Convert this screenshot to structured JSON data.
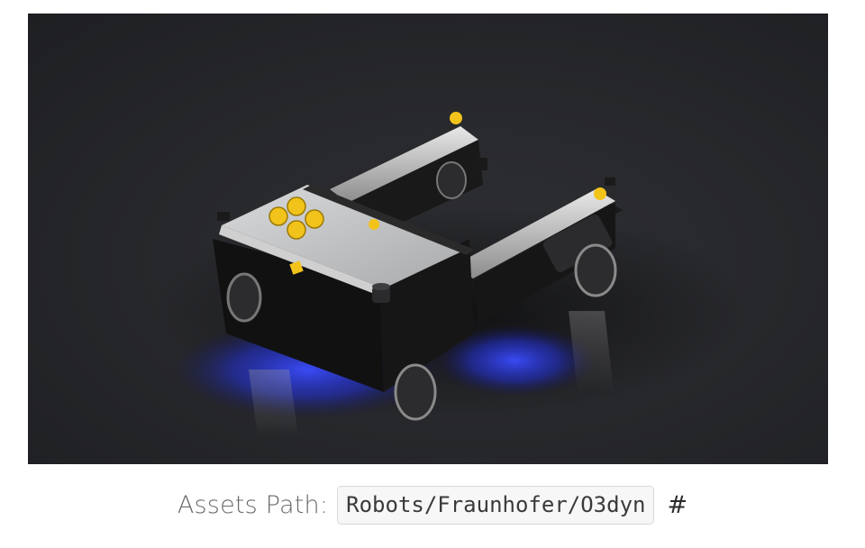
{
  "figure": {
    "image_alt": "O3dyn robot render",
    "background_color": "#26272a",
    "underglow_color": "#2a3bff",
    "accent_yellow": "#f2c31b"
  },
  "caption": {
    "label": "Assets Path:",
    "path": "Robots/Fraunhofer/O3dyn",
    "anchor": "#"
  }
}
